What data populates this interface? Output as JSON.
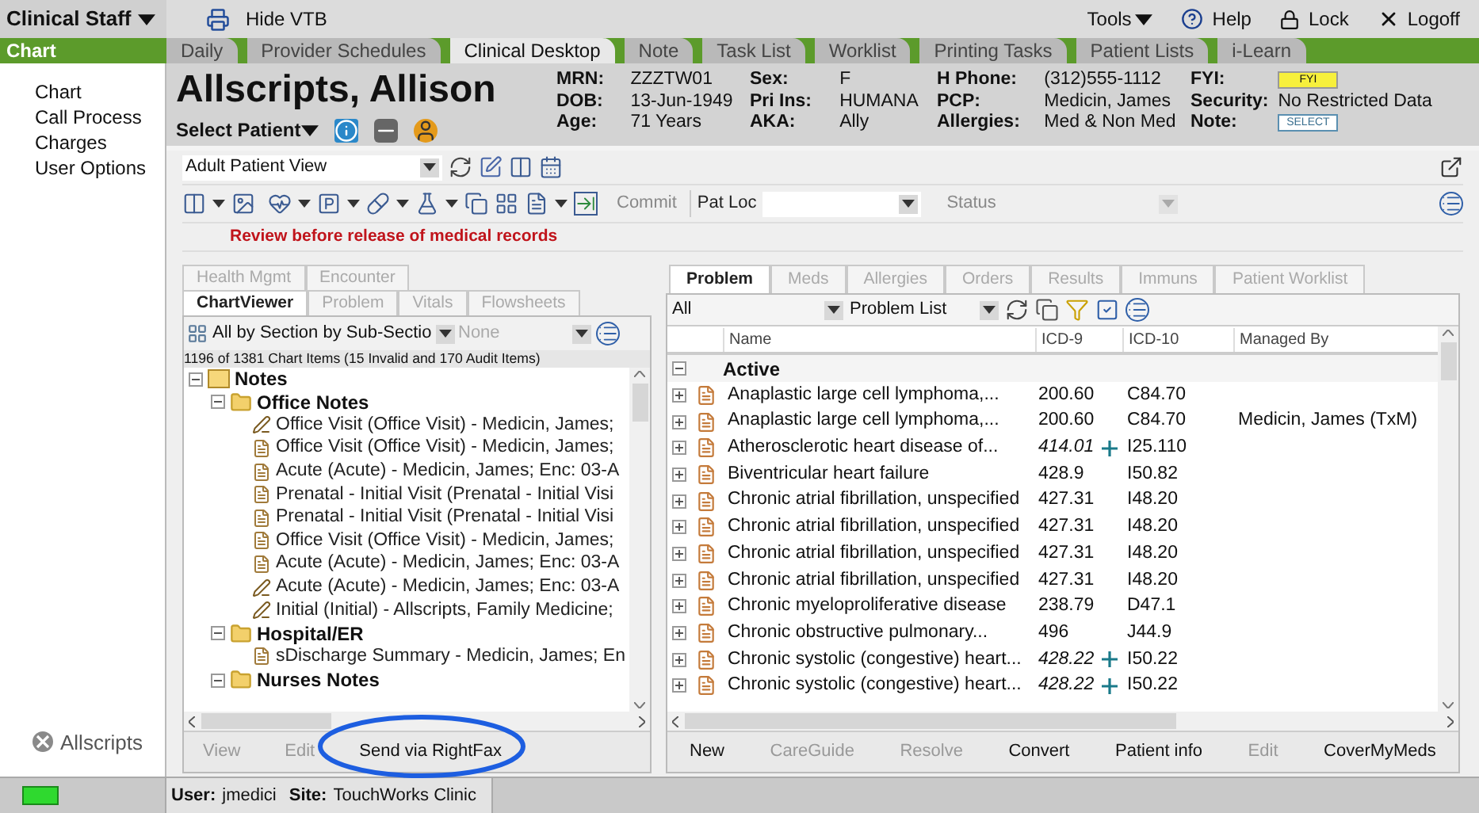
{
  "top_bar": {
    "role_menu": "Clinical Staff",
    "hide_vtb": "Hide VTB",
    "tools": "Tools",
    "help": "Help",
    "lock": "Lock",
    "logoff": "Logoff"
  },
  "nav": {
    "label": "Chart",
    "tabs": [
      {
        "label": "Daily",
        "selected": false
      },
      {
        "label": "Provider Schedules",
        "selected": false
      },
      {
        "label": "Clinical Desktop",
        "selected": true
      },
      {
        "label": "Note",
        "selected": false
      },
      {
        "label": "Task List",
        "selected": false
      },
      {
        "label": "Worklist",
        "selected": false
      },
      {
        "label": "Printing Tasks",
        "selected": false
      },
      {
        "label": "Patient Lists",
        "selected": false
      },
      {
        "label": "i-Learn",
        "selected": false
      }
    ]
  },
  "sidebar": {
    "items": [
      {
        "label": "Chart",
        "selected": false
      },
      {
        "label": "Call Process",
        "selected": false
      },
      {
        "label": "Charges",
        "selected": false
      },
      {
        "label": "User Options",
        "selected": false
      }
    ],
    "logo": "Allscripts"
  },
  "patient": {
    "name": "Allscripts, Allison",
    "select_patient": "Select Patient",
    "columns": [
      [
        {
          "label": "MRN:",
          "value": "ZZZTW01",
          "kind": "text"
        },
        {
          "label": "DOB:",
          "value": "13-Jun-1949",
          "kind": "text"
        },
        {
          "label": "Age:",
          "value": "71 Years",
          "kind": "text"
        }
      ],
      [
        {
          "label": "Sex:",
          "value": "F",
          "kind": "text"
        },
        {
          "label": "Pri Ins:",
          "value": "HUMANA",
          "kind": "text"
        },
        {
          "label": "AKA:",
          "value": "Ally",
          "kind": "text"
        }
      ],
      [
        {
          "label": "H Phone:",
          "value": "(312)555-1112",
          "kind": "text"
        },
        {
          "label": "PCP:",
          "value": "Medicin, James",
          "kind": "text"
        },
        {
          "label": "Allergies:",
          "value": "Med & Non Med",
          "kind": "text"
        }
      ],
      [
        {
          "label": "FYI:",
          "value": "FYI",
          "kind": "badge"
        },
        {
          "label": "Security:",
          "value": "No Restricted Data",
          "kind": "text"
        },
        {
          "label": "Note:",
          "value": "SELECT",
          "kind": "button"
        }
      ]
    ]
  },
  "toolbar": {
    "view": "Adult Patient View",
    "commit": "Commit",
    "pat_loc": "Pat Loc",
    "status": "Status",
    "notice": "Review before release of medical records"
  },
  "chart_viewer": {
    "tab_rows": [
      [
        {
          "label": "Health Mgmt",
          "selected": false
        },
        {
          "label": "Encounter",
          "selected": false
        }
      ],
      [
        {
          "label": "ChartViewer",
          "selected": true
        },
        {
          "label": "Problem",
          "selected": false
        },
        {
          "label": "Vitals",
          "selected": false
        },
        {
          "label": "Flowsheets",
          "selected": false
        }
      ]
    ],
    "filter": "All by Section by Sub-Sectio",
    "filter_2": "None",
    "count": "1196 of 1381 Chart Items (15 Invalid and 170 Audit Items)",
    "tree": [
      {
        "label": "Notes",
        "kind": "section",
        "expanded": true,
        "children": [
          {
            "label": "Office Notes",
            "kind": "folder",
            "expanded": true,
            "children": [
              {
                "label": "Office Visit (Office Visit) - Medicin, James;",
                "kind": "draft"
              },
              {
                "label": "Office Visit (Office Visit) - Medicin, James;",
                "kind": "document"
              },
              {
                "label": "Acute (Acute) - Medicin, James; Enc: 03-A",
                "kind": "document"
              },
              {
                "label": "Prenatal -  Initial Visit (Prenatal -  Initial Visi",
                "kind": "document"
              },
              {
                "label": "Prenatal -  Initial Visit (Prenatal -  Initial Visi",
                "kind": "document"
              },
              {
                "label": "Office Visit (Office Visit) - Medicin, James;",
                "kind": "document"
              },
              {
                "label": "Acute (Acute) - Medicin, James; Enc: 03-A",
                "kind": "document"
              },
              {
                "label": "Acute (Acute) - Medicin, James; Enc: 03-A",
                "kind": "draft"
              },
              {
                "label": "Initial (Initial) - Allscripts, Family Medicine;",
                "kind": "draft"
              }
            ]
          },
          {
            "label": "Hospital/ER",
            "kind": "folder",
            "expanded": true,
            "children": [
              {
                "label": "sDischarge Summary - Medicin, James; En",
                "kind": "document"
              }
            ]
          },
          {
            "label": "Nurses Notes",
            "kind": "folder",
            "expanded": true
          }
        ]
      }
    ],
    "actions": [
      {
        "label": "View",
        "disabled": true
      },
      {
        "label": "Edit",
        "disabled": true
      },
      {
        "label": "Send via RightFax",
        "disabled": false
      }
    ]
  },
  "problems": {
    "tabs": [
      {
        "label": "Problem",
        "selected": true
      },
      {
        "label": "Meds",
        "selected": false
      },
      {
        "label": "Allergies",
        "selected": false
      },
      {
        "label": "Orders",
        "selected": false
      },
      {
        "label": "Results",
        "selected": false
      },
      {
        "label": "Immuns",
        "selected": false
      },
      {
        "label": "Patient Worklist",
        "selected": false
      }
    ],
    "filter": "All",
    "list": "Problem List",
    "columns": [
      "Name",
      "ICD-9",
      "ICD-10",
      "Managed By"
    ],
    "group": {
      "label": "Active",
      "expanded": true
    },
    "rows": [
      {
        "name": "Anaplastic large cell lymphoma,...",
        "icd9": "200.60",
        "icd10": "C84.70",
        "mapped": false
      },
      {
        "name": "Anaplastic large cell lymphoma,...",
        "icd9": "200.60",
        "icd10": "C84.70",
        "managed_by": "Medicin, James (TxM)",
        "mapped": false
      },
      {
        "name": "Atherosclerotic heart disease of...",
        "icd9": "414.01",
        "icd10": "I25.110",
        "mapped": true
      },
      {
        "name": "Biventricular heart failure",
        "icd9": "428.9",
        "icd10": "I50.82",
        "mapped": false
      },
      {
        "name": "Chronic atrial fibrillation, unspecified",
        "icd9": "427.31",
        "icd10": "I48.20",
        "mapped": false
      },
      {
        "name": "Chronic atrial fibrillation, unspecified",
        "icd9": "427.31",
        "icd10": "I48.20",
        "mapped": false
      },
      {
        "name": "Chronic atrial fibrillation, unspecified",
        "icd9": "427.31",
        "icd10": "I48.20",
        "mapped": false
      },
      {
        "name": "Chronic atrial fibrillation, unspecified",
        "icd9": "427.31",
        "icd10": "I48.20",
        "mapped": false
      },
      {
        "name": "Chronic myeloproliferative disease",
        "icd9": "238.79",
        "icd10": "D47.1",
        "mapped": false
      },
      {
        "name": "Chronic obstructive pulmonary...",
        "icd9": "496",
        "icd10": "J44.9",
        "mapped": false
      },
      {
        "name": "Chronic systolic (congestive) heart...",
        "icd9": "428.22",
        "icd10": "I50.22",
        "mapped": true
      },
      {
        "name": "Chronic systolic (congestive) heart...",
        "icd9": "428.22",
        "icd10": "I50.22",
        "mapped": true
      }
    ],
    "actions": [
      {
        "label": "New",
        "disabled": false
      },
      {
        "label": "CareGuide",
        "disabled": true
      },
      {
        "label": "Resolve",
        "disabled": true
      },
      {
        "label": "Convert",
        "disabled": false
      },
      {
        "label": "Patient info",
        "disabled": false
      },
      {
        "label": "Edit",
        "disabled": true
      },
      {
        "label": "CoverMyMeds",
        "disabled": false
      }
    ]
  },
  "status_bar": {
    "user_label": "User:",
    "user": "jmedici",
    "site_label": "Site:",
    "site": "TouchWorks Clinic"
  }
}
